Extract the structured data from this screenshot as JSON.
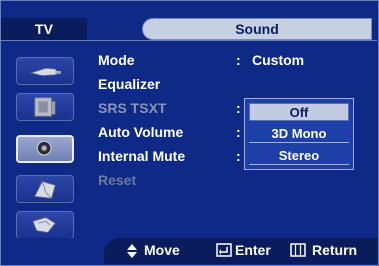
{
  "header": {
    "left_tab": "TV",
    "title": "Sound"
  },
  "sidebar": {
    "items": [
      {
        "icon": "picture-icon"
      },
      {
        "icon": "sound-icon"
      },
      {
        "icon": "speaker-icon",
        "active": true
      },
      {
        "icon": "channel-icon"
      },
      {
        "icon": "setup-icon"
      }
    ]
  },
  "menu": {
    "items": [
      {
        "label": "Mode",
        "value": "Custom"
      },
      {
        "label": "Equalizer"
      },
      {
        "label": "SRS TSXT"
      },
      {
        "label": "Auto Volume"
      },
      {
        "label": "Internal Mute"
      },
      {
        "label": "Reset"
      }
    ],
    "colon": ":"
  },
  "dropdown": {
    "options": [
      "Off",
      "3D Mono",
      "Stereo"
    ],
    "selected": "Off"
  },
  "footer": {
    "move": "Move",
    "enter": "Enter",
    "return": "Return"
  }
}
